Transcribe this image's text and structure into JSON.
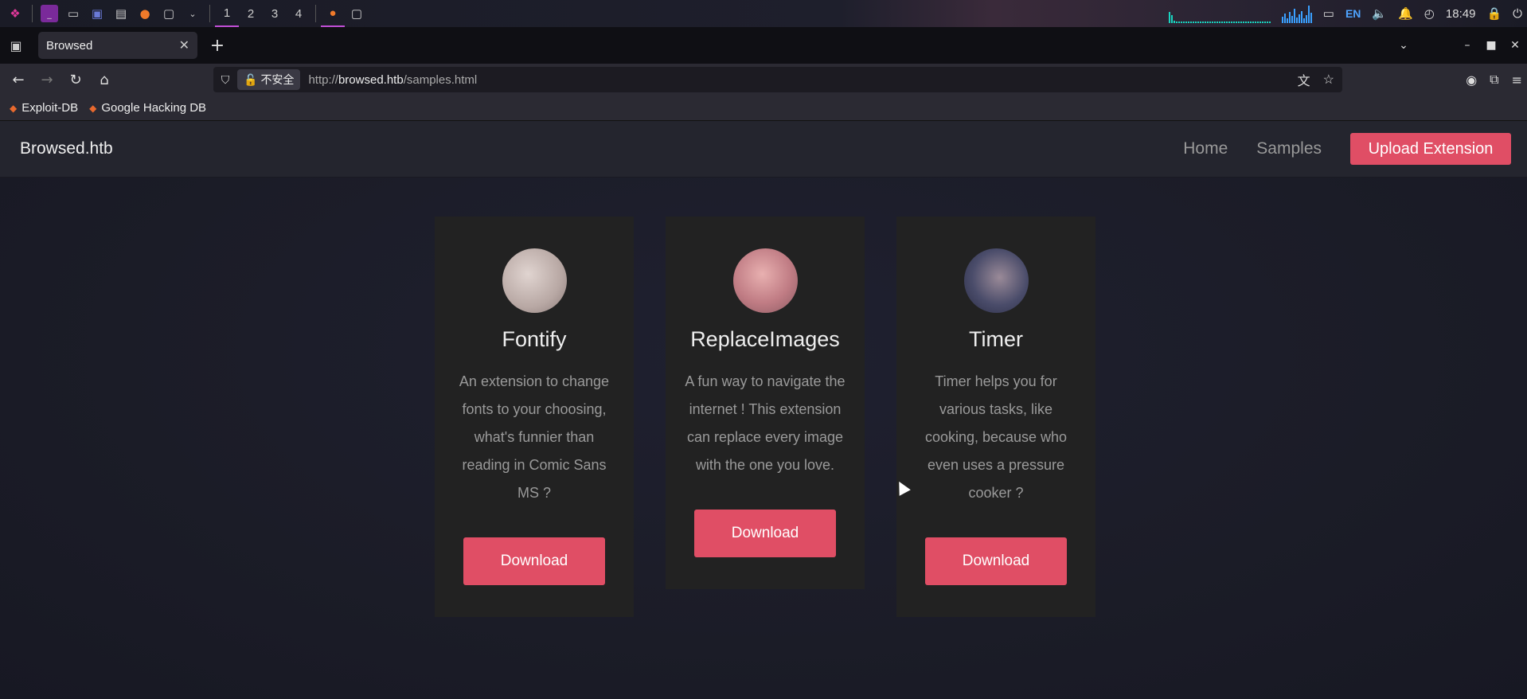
{
  "os": {
    "workspaces": [
      "1",
      "2",
      "3",
      "4"
    ],
    "keyboard_layout": "EN",
    "clock": "18:49"
  },
  "browser": {
    "tab_title": "Browsed",
    "url_security_label": "不安全",
    "url_prefix": "http://",
    "url_host": "browsed.htb",
    "url_path": "/samples.html",
    "bookmarks": [
      "Exploit-DB",
      "Google Hacking DB"
    ]
  },
  "site": {
    "brand": "Browsed.htb",
    "nav": {
      "home": "Home",
      "samples": "Samples",
      "upload": "Upload Extension"
    },
    "cards": [
      {
        "title": "Fontify",
        "description": "An extension to change fonts to your choosing, what's funnier than reading in Comic Sans MS ?",
        "button": "Download",
        "avatar_color": "#c9b8b4"
      },
      {
        "title": "ReplaceImages",
        "description": "A fun way to navigate the internet ! This extension can replace every image with the one you love.",
        "button": "Download",
        "avatar_color": "#c48a8e"
      },
      {
        "title": "Timer",
        "description": "Timer helps you for various tasks, like cooking, because who even uses a pressure cooker ?",
        "button": "Download",
        "avatar_color": "#4a4c6a"
      }
    ]
  },
  "colors": {
    "accent": "#e04e65",
    "card_bg": "#222222",
    "nav_bg": "#24252e"
  }
}
